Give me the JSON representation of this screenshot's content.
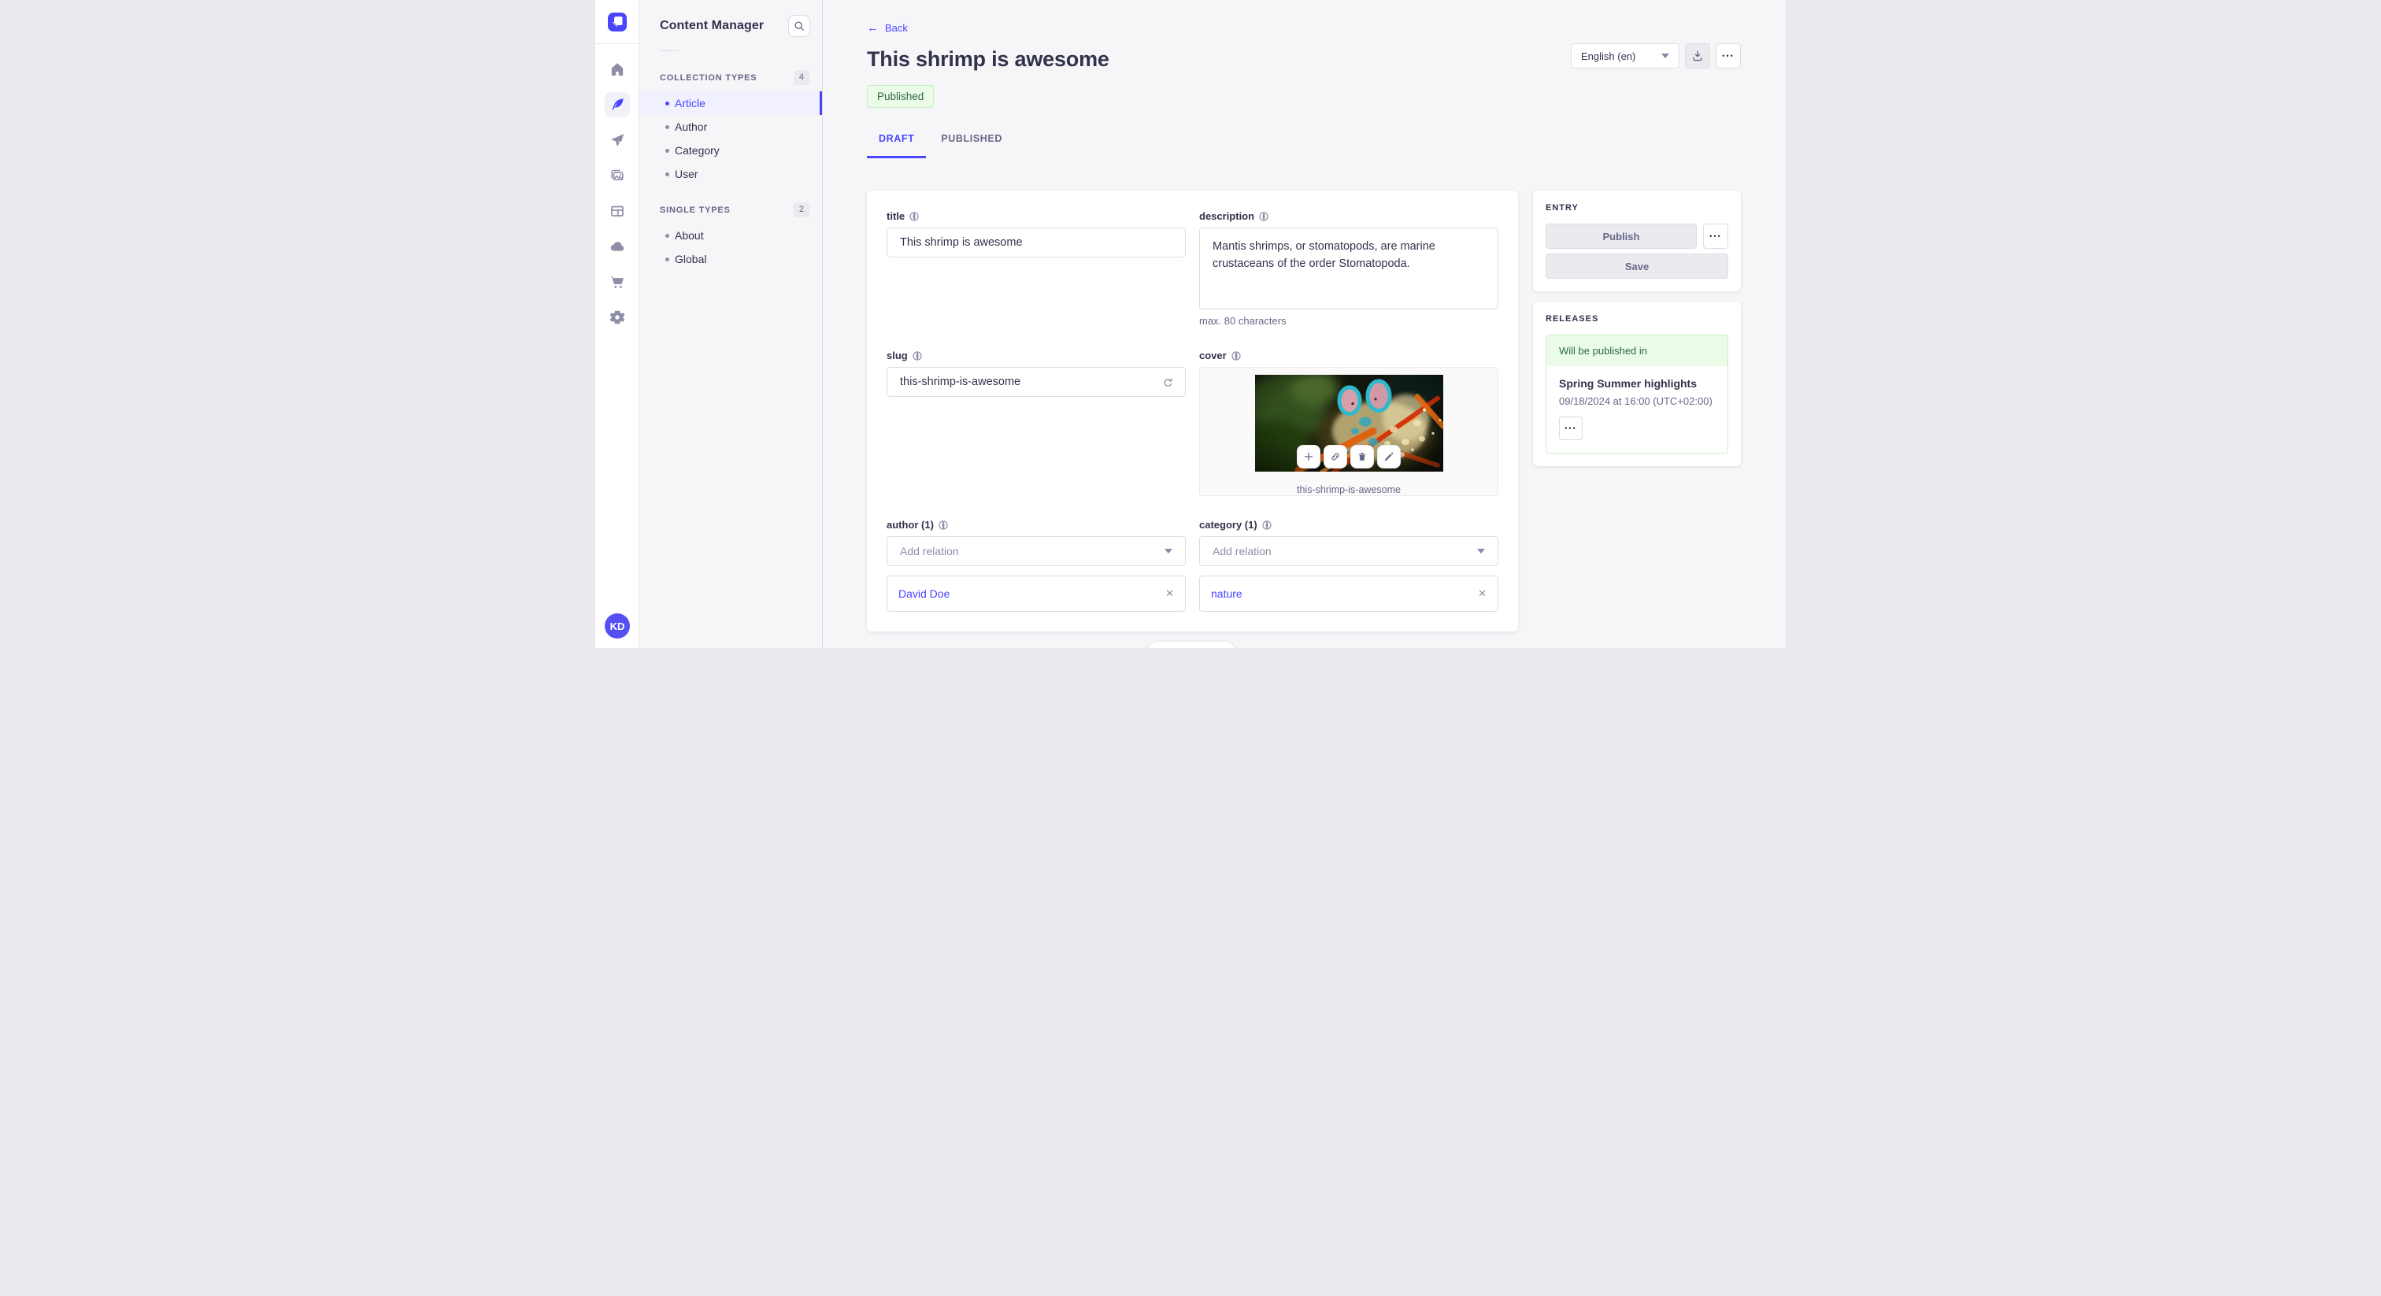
{
  "rail": {
    "icons": [
      "home-icon",
      "feather-icon",
      "send-icon",
      "images-icon",
      "layout-icon",
      "cloud-icon",
      "cart-icon",
      "gear-icon"
    ],
    "avatar_initials": "KD"
  },
  "subnav": {
    "title": "Content Manager",
    "collection_types": {
      "label": "COLLECTION TYPES",
      "count": "4",
      "items": [
        {
          "label": "Article",
          "active": true
        },
        {
          "label": "Author",
          "active": false
        },
        {
          "label": "Category",
          "active": false
        },
        {
          "label": "User",
          "active": false
        }
      ]
    },
    "single_types": {
      "label": "SINGLE TYPES",
      "count": "2",
      "items": [
        {
          "label": "About",
          "active": false
        },
        {
          "label": "Global",
          "active": false
        }
      ]
    }
  },
  "header": {
    "back_label": "Back",
    "title": "This shrimp is awesome",
    "status": "Published",
    "locale": "English (en)",
    "more": "•••"
  },
  "tabs": {
    "draft": "DRAFT",
    "published": "PUBLISHED"
  },
  "form": {
    "title": {
      "label": "title",
      "value": "This shrimp is awesome"
    },
    "description": {
      "label": "description",
      "value": "Mantis shrimps, or stomatopods, are marine crustaceans of the order Stomatopoda.",
      "hint": "max. 80 characters"
    },
    "slug": {
      "label": "slug",
      "value": "this-shrimp-is-awesome"
    },
    "cover": {
      "label": "cover",
      "caption": "this-shrimp-is-awesome"
    },
    "author": {
      "label": "author (1)",
      "placeholder": "Add relation",
      "relation": "David Doe",
      "remove": "✕"
    },
    "category": {
      "label": "category (1)",
      "placeholder": "Add relation",
      "relation": "nature",
      "remove": "✕"
    }
  },
  "entry_panel": {
    "heading": "ENTRY",
    "publish": "Publish",
    "save": "Save",
    "more": "•••"
  },
  "releases_panel": {
    "heading": "RELEASES",
    "status": "Will be published in",
    "name": "Spring Summer highlights",
    "date": "09/18/2024 at 16:00 (UTC+02:00)",
    "more": "•••"
  },
  "colors": {
    "primary": "#4945ff",
    "primary_light": "#f0f0ff",
    "success_text": "#2f6846",
    "success_bg": "#eafbe7",
    "success_border": "#c6f0c2",
    "background": "#f6f6f9"
  }
}
